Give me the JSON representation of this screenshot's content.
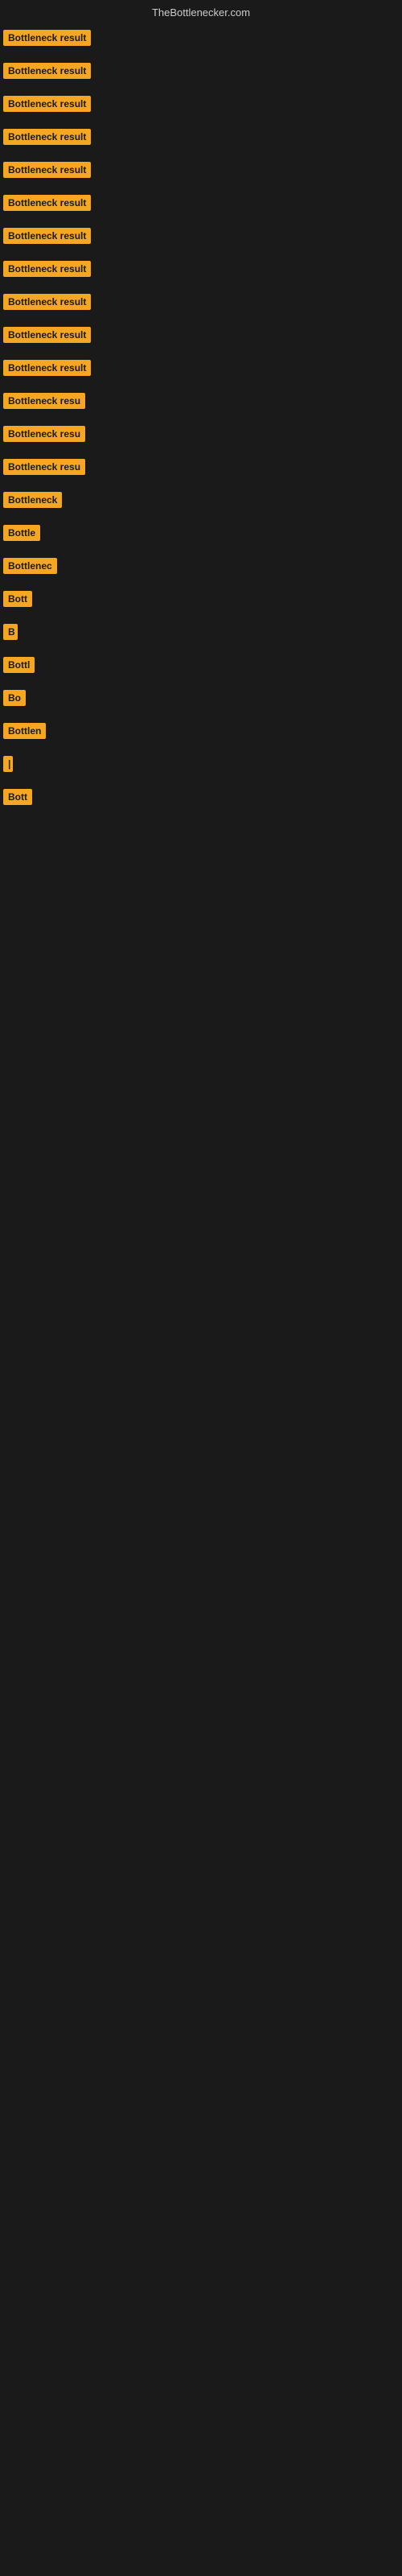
{
  "header": {
    "title": "TheBottlenecker.com"
  },
  "items": [
    {
      "label": "Bottleneck result",
      "width": 155
    },
    {
      "label": "Bottleneck result",
      "width": 155
    },
    {
      "label": "Bottleneck result",
      "width": 155
    },
    {
      "label": "Bottleneck result",
      "width": 155
    },
    {
      "label": "Bottleneck result",
      "width": 155
    },
    {
      "label": "Bottleneck result",
      "width": 155
    },
    {
      "label": "Bottleneck result",
      "width": 155
    },
    {
      "label": "Bottleneck result",
      "width": 155
    },
    {
      "label": "Bottleneck result",
      "width": 155
    },
    {
      "label": "Bottleneck result",
      "width": 155
    },
    {
      "label": "Bottleneck result",
      "width": 150
    },
    {
      "label": "Bottleneck resu",
      "width": 135
    },
    {
      "label": "Bottleneck resu",
      "width": 130
    },
    {
      "label": "Bottleneck resu",
      "width": 125
    },
    {
      "label": "Bottleneck",
      "width": 90
    },
    {
      "label": "Bottle",
      "width": 60
    },
    {
      "label": "Bottlenec",
      "width": 80
    },
    {
      "label": "Bott",
      "width": 45
    },
    {
      "label": "B",
      "width": 18
    },
    {
      "label": "Bottl",
      "width": 50
    },
    {
      "label": "Bo",
      "width": 30
    },
    {
      "label": "Bottlen",
      "width": 65
    },
    {
      "label": "|",
      "width": 10
    },
    {
      "label": "Bott",
      "width": 45
    }
  ]
}
